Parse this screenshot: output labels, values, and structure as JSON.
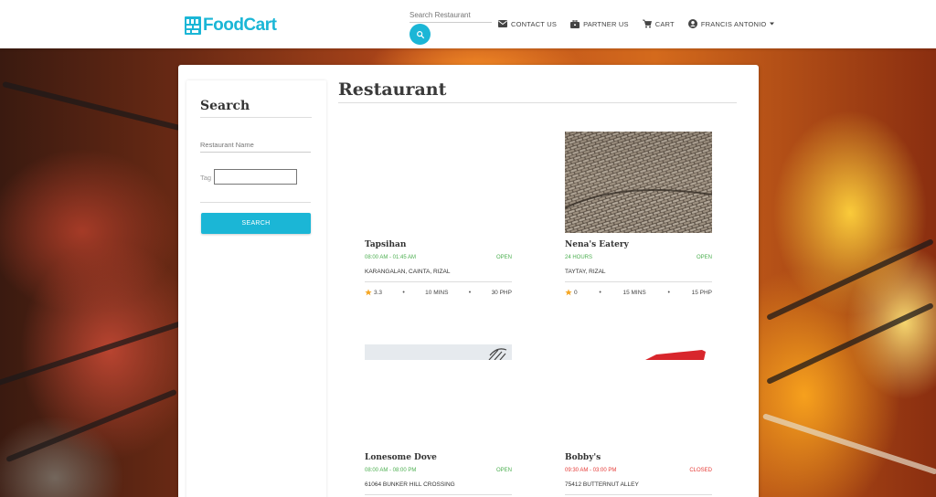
{
  "header": {
    "logo_text": "FoodCart",
    "search_placeholder": "Search Restaurant",
    "nav": {
      "contact": "CONTACT US",
      "partner": "PARTNER US",
      "cart": "CART",
      "user": "FRANCIS ANTONIO"
    }
  },
  "sidebar": {
    "title": "Search",
    "name_placeholder": "Restaurant Name",
    "tag_label": "Tag",
    "search_button": "SEARCH"
  },
  "main": {
    "title": "Restaurant",
    "restaurants": [
      {
        "name": "Tapsihan",
        "hours": "08:00 AM - 01:45 AM",
        "status": "OPEN",
        "address": "KARANGALAN, CAINTA, RIZAL",
        "rating": "3.3",
        "time": "10 MINS",
        "price": "30 PHP"
      },
      {
        "name": "Nena's Eatery",
        "hours": "24 HOURS",
        "status": "OPEN",
        "address": "TAYTAY, RIZAL",
        "rating": "0",
        "time": "15 MINS",
        "price": "15 PHP"
      },
      {
        "name": "Lonesome Dove",
        "hours": "08:00 AM - 08:00 PM",
        "status": "OPEN",
        "address": "61064 BUNKER HILL CROSSING"
      },
      {
        "name": "Bobby's",
        "hours": "09:30 AM - 03:00 PM",
        "status": "CLOSED",
        "address": "75412 BUTTERNUT ALLEY"
      }
    ]
  },
  "colors": {
    "accent": "#1bb6d6",
    "open": "#4caf50",
    "closed": "#e53935",
    "star": "#f5a623"
  },
  "icons": [
    "search-icon",
    "mail-icon",
    "briefcase-icon",
    "cart-icon",
    "account-circle-icon",
    "caret-down-icon",
    "star-icon"
  ]
}
